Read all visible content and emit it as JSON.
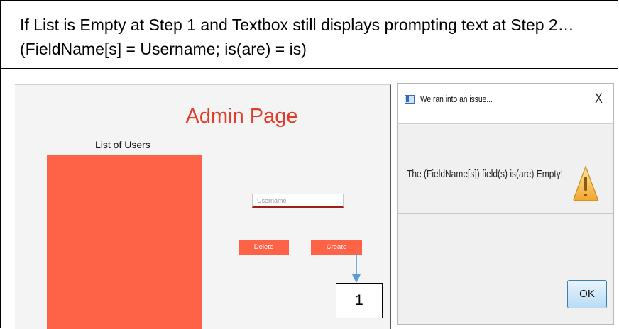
{
  "caption": {
    "text": "If List is Empty at Step 1 and Textbox still displays prompting text at Step 2… (FieldName[s] = Username; is(are) = is)"
  },
  "admin_page": {
    "title": "Admin Page",
    "list_label": "List of Users",
    "username_placeholder": "Username",
    "delete_label": "Delete",
    "create_label": "Create",
    "step_label": "1",
    "colors": {
      "accent": "#ff6347",
      "title": "#e23b2a",
      "arrow": "#5b9bd5"
    }
  },
  "dialog": {
    "title": "We ran into an issue...",
    "close_label": "X",
    "message": "The (FieldName[s]) field(s) is(are) Empty!",
    "ok_label": "OK",
    "icon": "warning-icon"
  }
}
